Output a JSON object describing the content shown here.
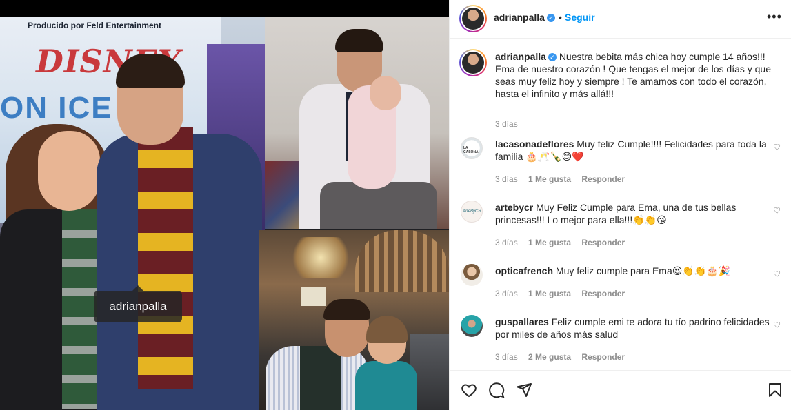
{
  "media": {
    "tag_username": "adrianpalla",
    "banner_line": "Producido por Feld Entertainment",
    "banner_logo": "DISNEY",
    "banner_show": "ON ICE"
  },
  "header": {
    "username": "adrianpalla",
    "separator": "•",
    "follow_label": "Seguir",
    "more_icon": "more-icon"
  },
  "caption": {
    "username": "adrianpalla",
    "text": "Nuestra bebita más chica hoy cumple 14 años!!! Ema de nuestro corazón ! Que tengas el mejor de los días y que seas muy feliz hoy y siempre ! Te amamos con todo el corazón, hasta el infinito y más allá!!!",
    "time": "3 días"
  },
  "comments": [
    {
      "username": "lacasonadeflores",
      "text": "Muy feliz Cumple!!!! Felicidades para toda la familia 🎂🥂🍾😊❤️",
      "time": "3 días",
      "likes": "1 Me gusta",
      "reply": "Responder"
    },
    {
      "username": "artebycr",
      "text": "Muy Feliz Cumple para Ema, una de tus bellas princesas!!! Lo mejor para ella!!!👏👏😘",
      "time": "3 días",
      "likes": "1 Me gusta",
      "reply": "Responder"
    },
    {
      "username": "opticafrench",
      "text": "Muy feliz cumple para Ema😍👏👏🎂🎉",
      "time": "3 días",
      "likes": "1 Me gusta",
      "reply": "Responder"
    },
    {
      "username": "guspallares",
      "text": "Feliz cumple emi te adora tu tío padrino felicidades por miles de años más salud",
      "time": "3 días",
      "likes": "2 Me gusta",
      "reply": "Responder"
    }
  ],
  "actions": {
    "icons": [
      "heart-icon",
      "comment-icon",
      "share-icon",
      "bookmark-icon"
    ]
  },
  "colors": {
    "accent": "#0095f6",
    "verified": "#3897f0",
    "muted": "#8e8e8e",
    "text": "#262626"
  }
}
